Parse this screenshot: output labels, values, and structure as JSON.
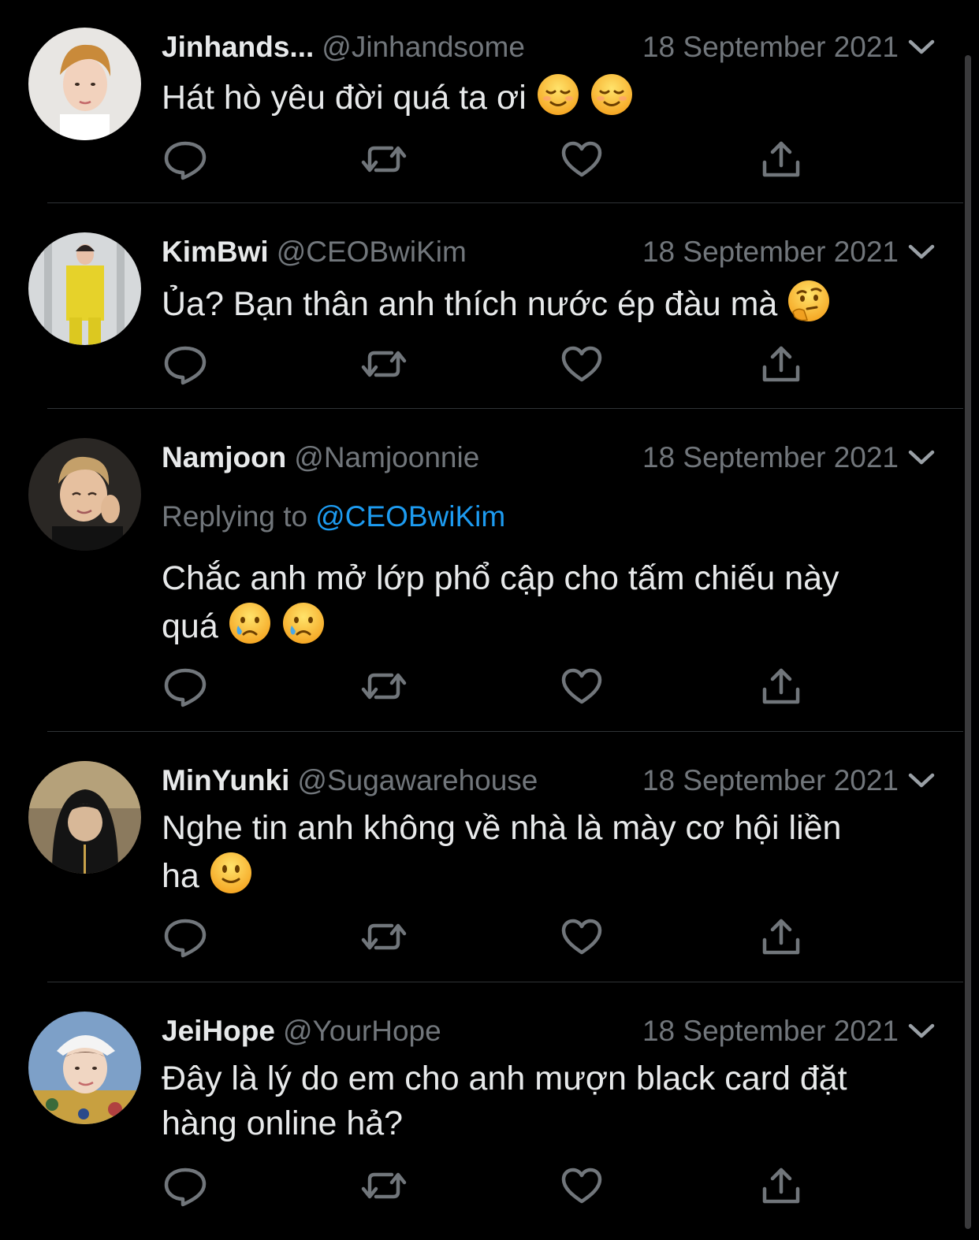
{
  "colors": {
    "background": "#000000",
    "text": "#e7e9ea",
    "secondary": "#71767b",
    "link": "#1d9bf0",
    "divider": "#2f3336"
  },
  "icons": {
    "reply": "speech-bubble-icon",
    "retweet": "retweet-icon",
    "like": "heart-icon",
    "share": "share-upload-icon",
    "menu": "chevron-down-icon"
  },
  "tweets": [
    {
      "name": "Jinhands...",
      "handle": "@Jinhandsome",
      "time": "18 September 2021",
      "text": "Hát hò yêu đời quá ta ơi",
      "emojis": [
        "relieved-face",
        "relieved-face"
      ]
    },
    {
      "name": "KimBwi",
      "handle": "@CEOBwiKim",
      "time": "18 September 2021",
      "text": "Ủa? Bạn thân anh thích nước ép đàu mà",
      "emojis": [
        "thinking-face"
      ]
    },
    {
      "name": "Namjoon",
      "handle": "@Namjoonnie",
      "time": "18 September 2021",
      "replying_label": "Replying to",
      "replying_to": "@CEOBwiKim",
      "text_line1": "Chắc anh mở lớp phổ cập cho tấm chiếu này",
      "text_line2": "quá",
      "emojis": [
        "crying-face",
        "crying-face"
      ]
    },
    {
      "name": "MinYunki",
      "handle": "@Sugawarehouse",
      "time": "18 September 2021",
      "text_line1": "Nghe tin anh không về nhà là mày cơ hội liền",
      "text_line2": "ha",
      "emojis": [
        "slightly-smiling-face"
      ]
    },
    {
      "name": "JeiHope",
      "handle": "@YourHope",
      "time": "18 September 2021",
      "text_line1": "Đây là lý do em cho anh mượn black card đặt",
      "text_line2": "hàng online hả?"
    }
  ]
}
